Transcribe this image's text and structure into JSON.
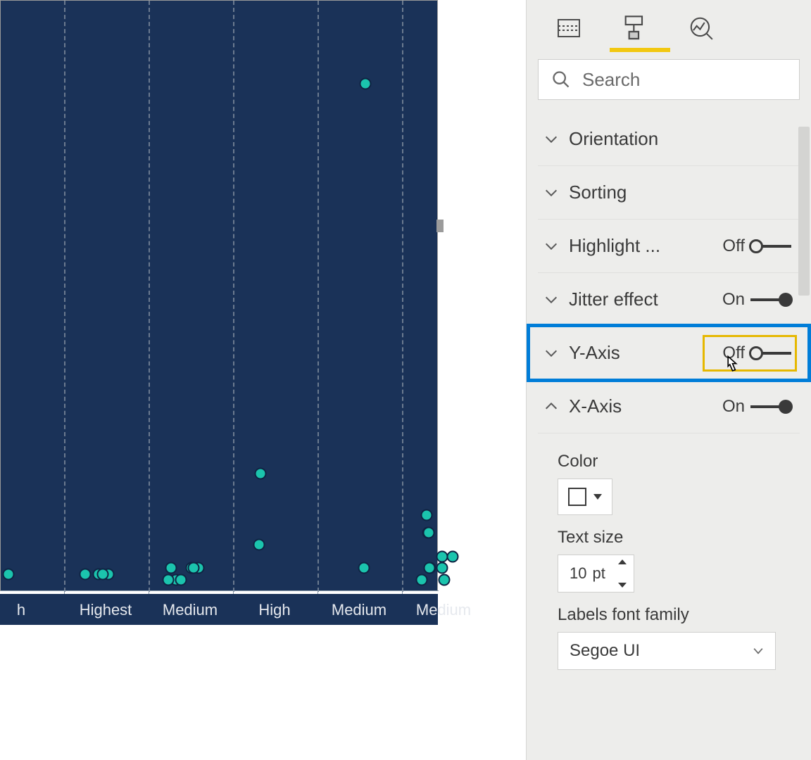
{
  "search": {
    "placeholder": "Search"
  },
  "panel": {
    "items": [
      {
        "label": "Orientation",
        "has_toggle": false,
        "expanded": false
      },
      {
        "label": "Sorting",
        "has_toggle": false,
        "expanded": false
      },
      {
        "label": "Highlight ...",
        "has_toggle": true,
        "state": "Off",
        "expanded": false
      },
      {
        "label": "Jitter effect",
        "has_toggle": true,
        "state": "On",
        "expanded": false
      },
      {
        "label": "Y-Axis",
        "has_toggle": true,
        "state": "Off",
        "expanded": false,
        "focused": true
      },
      {
        "label": "X-Axis",
        "has_toggle": true,
        "state": "On",
        "expanded": true
      }
    ]
  },
  "xaxis_props": {
    "color_label": "Color",
    "color_value": "#ffffff",
    "text_size_label": "Text size",
    "text_size_value": "10",
    "text_size_unit": "pt",
    "font_label": "Labels font family",
    "font_value": "Segoe UI"
  },
  "chart_data": {
    "type": "scatter",
    "categories": [
      "h",
      "Highest",
      "Medium",
      "High",
      "Medium",
      "Medium"
    ],
    "xlabel": "",
    "ylabel": "",
    "ylim": [
      0,
      100
    ],
    "series": [
      {
        "name": "points",
        "points": [
          {
            "cat": 0,
            "y": 3
          },
          {
            "cat": 1,
            "y": 3
          },
          {
            "cat": 1,
            "y": 3
          },
          {
            "cat": 1,
            "y": 3
          },
          {
            "cat": 1,
            "y": 3
          },
          {
            "cat": 2,
            "y": 2
          },
          {
            "cat": 2,
            "y": 2
          },
          {
            "cat": 2,
            "y": 2
          },
          {
            "cat": 2,
            "y": 4
          },
          {
            "cat": 2,
            "y": 4
          },
          {
            "cat": 2,
            "y": 4
          },
          {
            "cat": 2,
            "y": 4
          },
          {
            "cat": 3,
            "y": 8
          },
          {
            "cat": 3,
            "y": 20
          },
          {
            "cat": 4,
            "y": 4
          },
          {
            "cat": 4,
            "y": 86
          },
          {
            "cat": 5,
            "y": 2
          },
          {
            "cat": 5,
            "y": 2
          },
          {
            "cat": 5,
            "y": 4
          },
          {
            "cat": 5,
            "y": 4
          },
          {
            "cat": 5,
            "y": 4
          },
          {
            "cat": 5,
            "y": 6
          },
          {
            "cat": 5,
            "y": 6
          },
          {
            "cat": 5,
            "y": 10
          },
          {
            "cat": 5,
            "y": 10
          },
          {
            "cat": 5,
            "y": 13
          }
        ]
      }
    ]
  }
}
